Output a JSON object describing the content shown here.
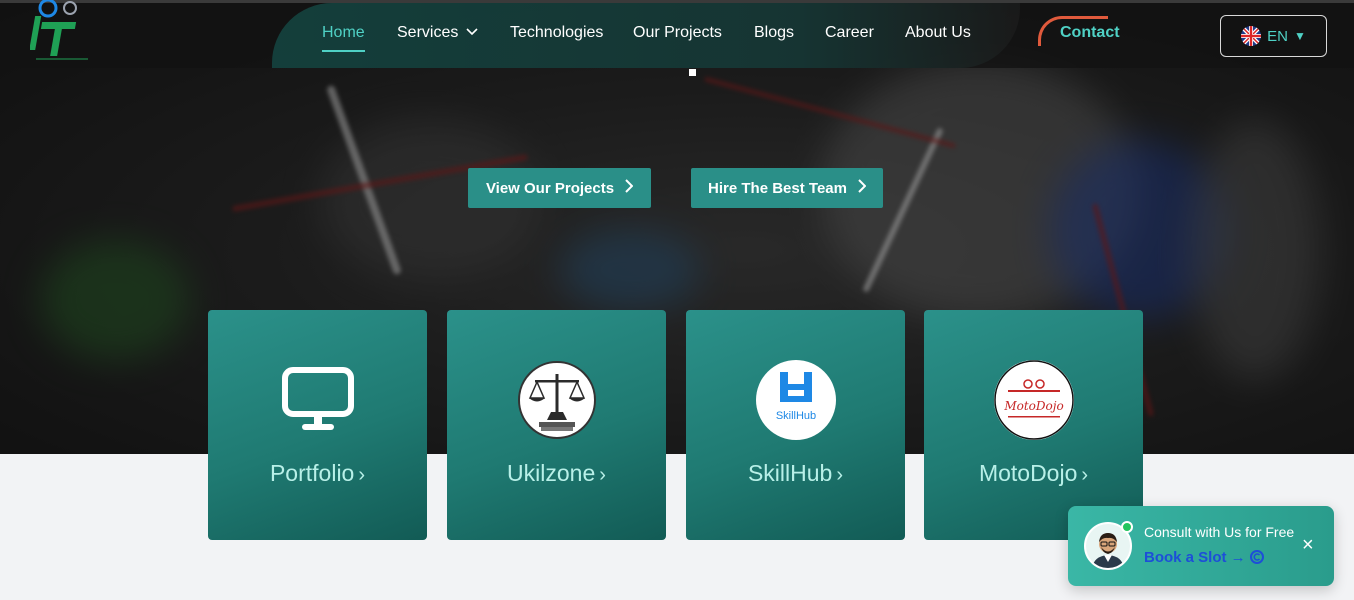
{
  "colors": {
    "accent": "#4fd1c5",
    "button": "#2a8f88",
    "card_top": "#2b918a",
    "card_bottom": "#125b55",
    "contact_arc": "#e05a3c",
    "consult_bg": "#3ab7a6",
    "consult_link": "#1d4ed8"
  },
  "logo": {
    "icon": "company-logo"
  },
  "nav": {
    "items": [
      {
        "label": "Home",
        "active": true
      },
      {
        "label": "Services",
        "has_dropdown": true,
        "icon": "chevron-down-icon"
      },
      {
        "label": "Technologies"
      },
      {
        "label": "Our Projects"
      },
      {
        "label": "Blogs"
      },
      {
        "label": "Career"
      },
      {
        "label": "About Us"
      }
    ],
    "contact_label": "Contact",
    "language": {
      "code": "EN",
      "flag": "uk-flag-icon",
      "caret": "▼"
    }
  },
  "hero": {
    "buttons": [
      {
        "label": "View Our Projects",
        "icon": "chevron-right-icon"
      },
      {
        "label": "Hire The Best Team",
        "icon": "chevron-right-icon"
      }
    ]
  },
  "cards": [
    {
      "label": "Portfolio",
      "arrow": "›",
      "icon": "monitor-icon"
    },
    {
      "label": "Ukilzone",
      "arrow": "›",
      "icon": "scales-of-justice-logo"
    },
    {
      "label": "SkillHub",
      "arrow": "›",
      "icon": "skillhub-logo",
      "logo_text": "SkillHub"
    },
    {
      "label": "MotoDojo",
      "arrow": "›",
      "icon": "motodojo-logo",
      "logo_text": "MotoDojo"
    }
  ],
  "consult": {
    "title": "Consult with Us for Free",
    "link": "Book a Slot →",
    "close": "×"
  }
}
